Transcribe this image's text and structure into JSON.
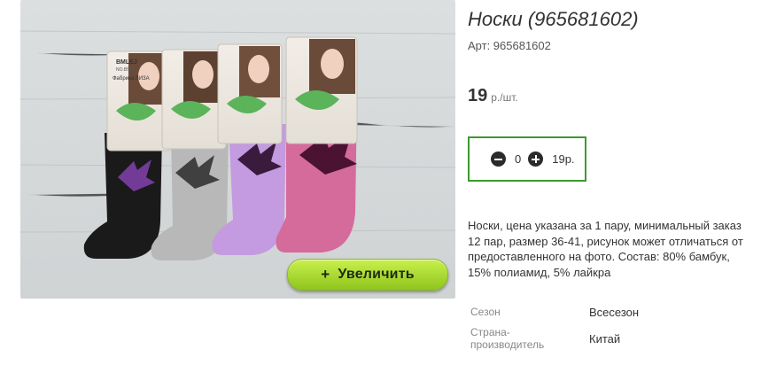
{
  "product": {
    "title": "Носки (965681602)",
    "sku": "Арт: 965681602",
    "price_value": "19",
    "price_unit": "р./шт.",
    "zoom_label": "Увеличить",
    "zoom_plus": "+",
    "photo_brand": "BMLEJ",
    "photo_factory": "Фабрика ЛИЗА",
    "photo_code": "NO.B585"
  },
  "cart": {
    "quantity": "0",
    "total": "19р."
  },
  "description": "Носки, цена указана за 1 пару, минимальный заказ 12 пар, размер 36-41, рисунок может отличаться от предоставленного на фото. Состав: 80% бамбук, 15% полиамид, 5% лайкра",
  "properties": [
    {
      "label": "Сезон",
      "value": "Всесезон"
    },
    {
      "label": "Страна-производитель",
      "value": "Китай"
    }
  ],
  "colors": {
    "accent_green": "#3a9a2c",
    "button_green": "#a6d833",
    "sock_black": "#1a1a1a",
    "sock_gray": "#b8b8b8",
    "sock_lilac": "#c49ae0",
    "sock_pink": "#d46b9b"
  }
}
